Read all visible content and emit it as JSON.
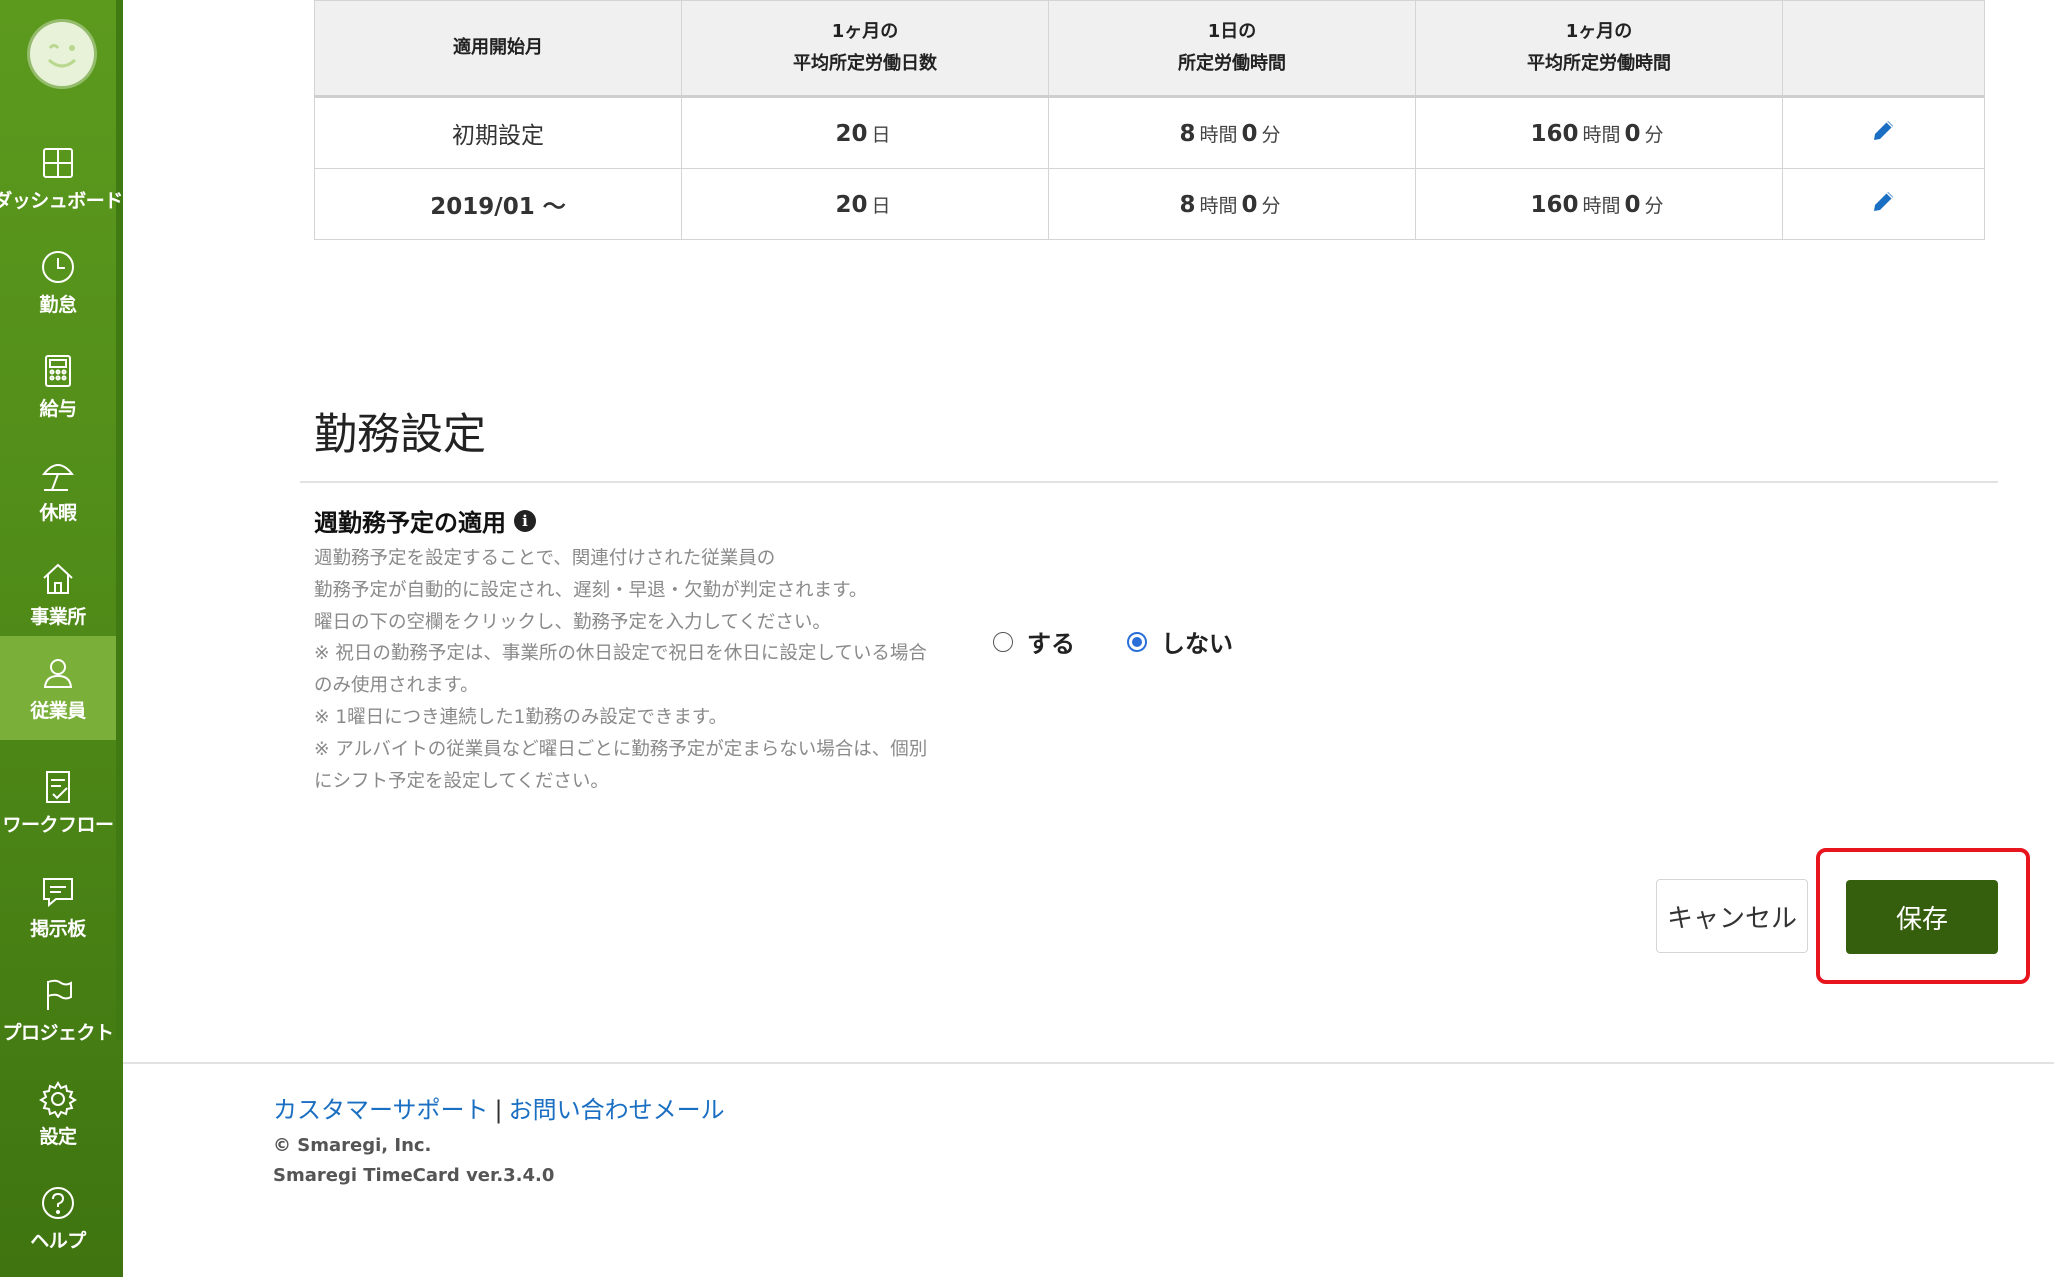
{
  "sidebar": {
    "items": [
      {
        "label": "ダッシュボード",
        "icon": "dashboard-icon"
      },
      {
        "label": "勤怠",
        "icon": "clock-icon"
      },
      {
        "label": "給与",
        "icon": "calculator-icon"
      },
      {
        "label": "休暇",
        "icon": "beach-umbrella-icon"
      },
      {
        "label": "事業所",
        "icon": "home-icon"
      },
      {
        "label": "従業員",
        "icon": "person-icon"
      },
      {
        "label": "ワークフロー",
        "icon": "clipboard-check-icon"
      },
      {
        "label": "掲示板",
        "icon": "message-icon"
      },
      {
        "label": "プロジェクト",
        "icon": "flag-icon"
      },
      {
        "label": "設定",
        "icon": "gear-icon"
      },
      {
        "label": "ヘルプ",
        "icon": "help-icon"
      }
    ],
    "active": "従業員"
  },
  "table": {
    "headers": [
      {
        "line1": "適用開始月",
        "line2": ""
      },
      {
        "line1": "1ヶ月の",
        "line2": "平均所定労働日数"
      },
      {
        "line1": "1日の",
        "line2": "所定労働時間"
      },
      {
        "line1": "1ヶ月の",
        "line2": "平均所定労働時間"
      },
      {
        "line1": "",
        "line2": ""
      }
    ],
    "rows": [
      {
        "start": "初期設定",
        "days": "20",
        "days_unit": "日",
        "day_h": "8",
        "day_m": "0",
        "month_h": "160",
        "month_m": "0",
        "hour_unit": "時間",
        "min_unit": "分"
      },
      {
        "start": "2019/01 〜",
        "days": "20",
        "days_unit": "日",
        "day_h": "8",
        "day_m": "0",
        "month_h": "160",
        "month_m": "0",
        "hour_unit": "時間",
        "min_unit": "分"
      }
    ]
  },
  "section": {
    "title": "勤務設定",
    "field_label": "週勤務予定の適用",
    "info_glyph": "i",
    "description": [
      "週勤務予定を設定することで、関連付けされた従業員の",
      "勤務予定が自動的に設定され、遅刻・早退・欠勤が判定されます。",
      "曜日の下の空欄をクリックし、勤務予定を入力してください。",
      "※ 祝日の勤務予定は、事業所の休日設定で祝日を休日に設定している場合",
      "のみ使用されます。",
      "※ 1曜日につき連続した1勤務のみ設定できます。",
      "※ アルバイトの従業員など曜日ごとに勤務予定が定まらない場合は、個別",
      "にシフト予定を設定してください。"
    ],
    "radio": {
      "options": [
        "する",
        "しない"
      ],
      "selected": "しない"
    }
  },
  "buttons": {
    "cancel": "キャンセル",
    "save": "保存"
  },
  "footer": {
    "support_link": "カスタマーサポート",
    "separator": "|",
    "contact_link": "お問い合わせメール",
    "copyright": "© Smaregi, Inc.",
    "version": "Smaregi TimeCard ver.3.4.0"
  },
  "colors": {
    "sidebar_green": "#4f8a18",
    "save_button": "#355f0d",
    "highlight_red": "#e8141e",
    "link_blue": "#1a6fc2",
    "radio_blue": "#2a6fd8"
  }
}
